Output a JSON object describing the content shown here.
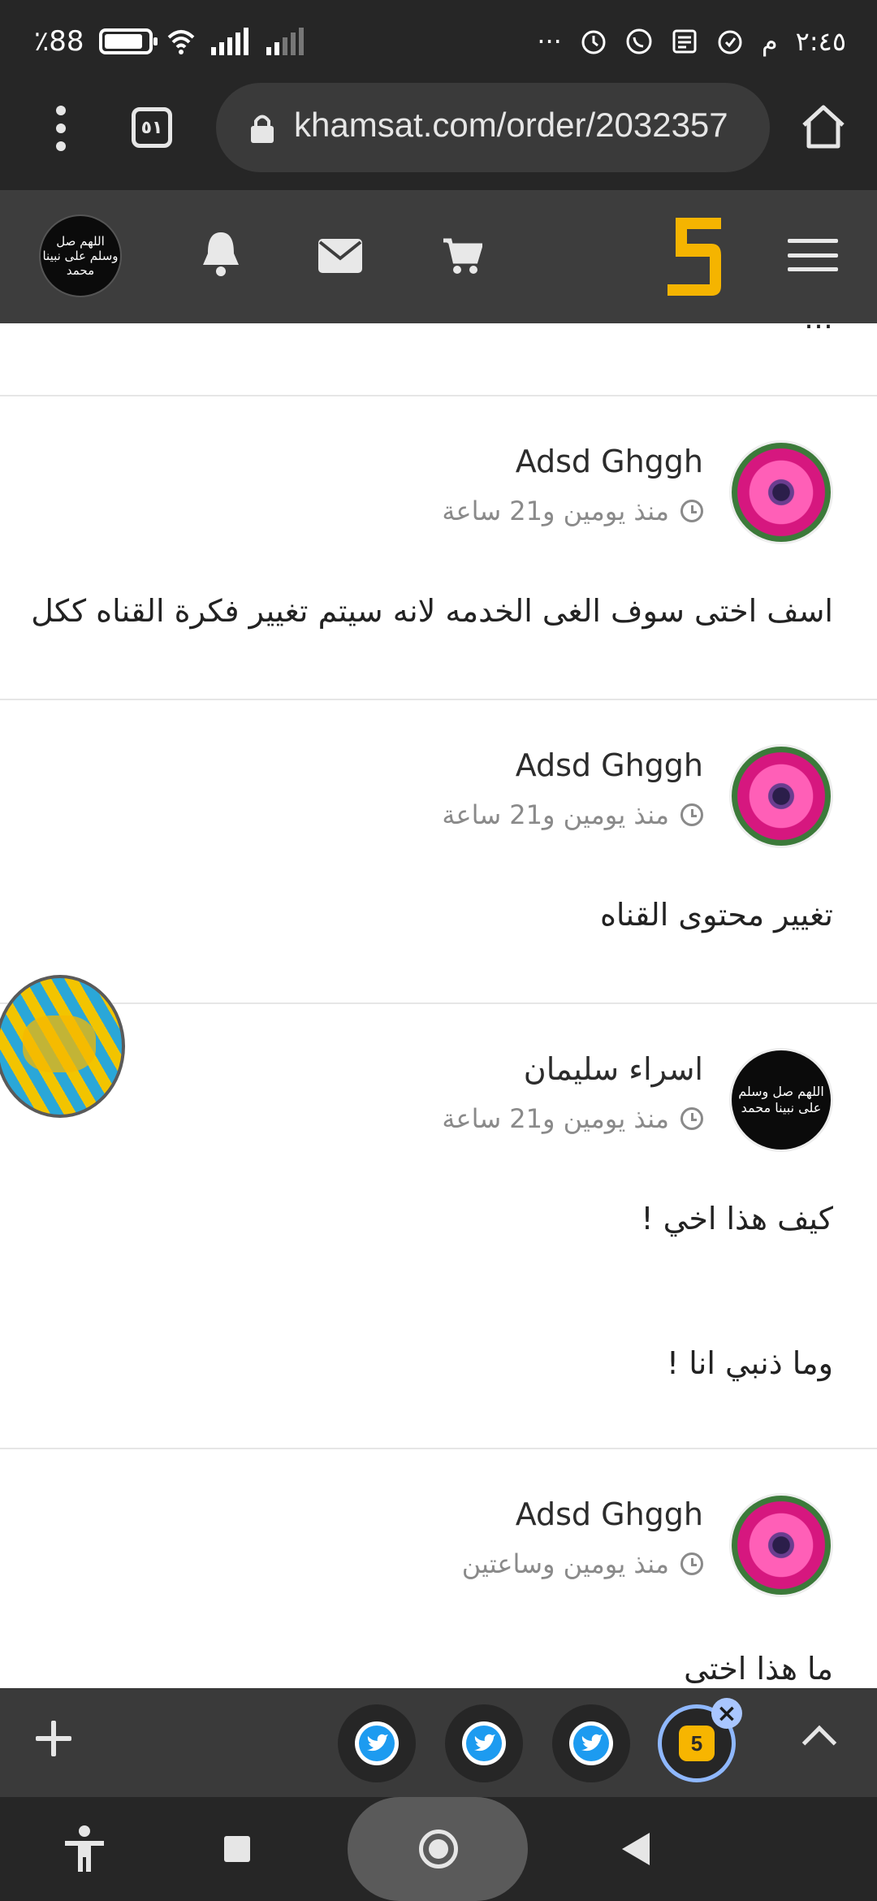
{
  "status_bar": {
    "battery": "88",
    "battery_unit": "٪",
    "time": "٢:٤٥",
    "ampm": "م",
    "more": "···"
  },
  "browser": {
    "url": "khamsat.com/order/2032357",
    "tab_count": "٥١"
  },
  "site_header": {
    "avatar_text": "اللهم صل وسلم على نبينا محمد",
    "icons": [
      "bell-icon",
      "mail-icon",
      "cart-icon",
      "khamsat-logo",
      "menu-icon"
    ],
    "accent_color": "#f5b400"
  },
  "comments": [
    {
      "author": "Adsd Ghggh",
      "time": "منذ يومين و21 ساعة",
      "avatar": "flower",
      "body": [
        "اسف اختى سوف الغى الخدمه لانه سيتم تغيير فكرة القناه ككل"
      ]
    },
    {
      "author": "Adsd Ghggh",
      "time": "منذ يومين و21 ساعة",
      "avatar": "flower",
      "body": [
        "تغيير محتوى القناه"
      ]
    },
    {
      "author": "اسراء سليمان",
      "time": "منذ يومين و21 ساعة",
      "avatar": "dark",
      "avatar_text": "اللهم صل وسلم على نبينا محمد",
      "body": [
        "كيف هذا اخي !",
        "وما ذنبي انا !"
      ]
    },
    {
      "author": "Adsd Ghggh",
      "time": "منذ يومين وساعتين",
      "avatar": "flower",
      "body": [
        "ما هذا اختى"
      ]
    }
  ],
  "tab_strip": {
    "active_tab_label": "5",
    "tabs": [
      "twitter-icon",
      "twitter-icon",
      "twitter-icon",
      "khamsat-icon"
    ]
  }
}
